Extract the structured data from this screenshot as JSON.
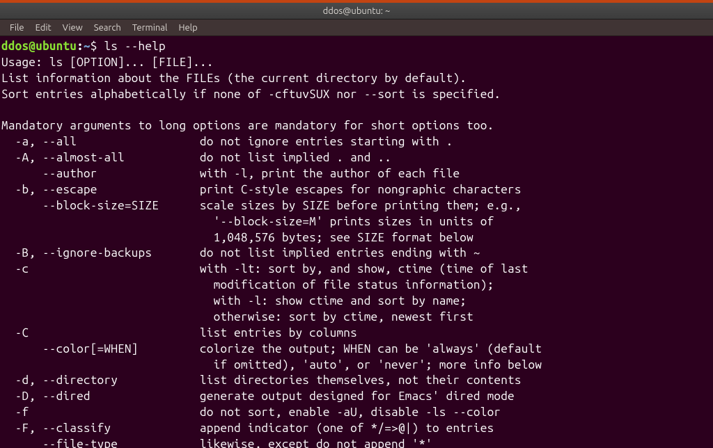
{
  "window": {
    "title": "ddos@ubuntu: ~"
  },
  "menu": {
    "file": "File",
    "edit": "Edit",
    "view": "View",
    "search": "Search",
    "terminal": "Terminal",
    "help": "Help"
  },
  "prompt": {
    "user_host": "ddos@ubuntu",
    "sep": ":",
    "path": "~",
    "dollar": "$ "
  },
  "command": "ls --help",
  "output": [
    "Usage: ls [OPTION]... [FILE]...",
    "List information about the FILEs (the current directory by default).",
    "Sort entries alphabetically if none of -cftuvSUX nor --sort is specified.",
    "",
    "Mandatory arguments to long options are mandatory for short options too.",
    "  -a, --all                  do not ignore entries starting with .",
    "  -A, --almost-all           do not list implied . and ..",
    "      --author               with -l, print the author of each file",
    "  -b, --escape               print C-style escapes for nongraphic characters",
    "      --block-size=SIZE      scale sizes by SIZE before printing them; e.g.,",
    "                               '--block-size=M' prints sizes in units of",
    "                               1,048,576 bytes; see SIZE format below",
    "  -B, --ignore-backups       do not list implied entries ending with ~",
    "  -c                         with -lt: sort by, and show, ctime (time of last",
    "                               modification of file status information);",
    "                               with -l: show ctime and sort by name;",
    "                               otherwise: sort by ctime, newest first",
    "  -C                         list entries by columns",
    "      --color[=WHEN]         colorize the output; WHEN can be 'always' (default",
    "                               if omitted), 'auto', or 'never'; more info below",
    "  -d, --directory            list directories themselves, not their contents",
    "  -D, --dired                generate output designed for Emacs' dired mode",
    "  -f                         do not sort, enable -aU, disable -ls --color",
    "  -F, --classify             append indicator (one of */=>@|) to entries",
    "      --file-type            likewise, except do not append '*'"
  ]
}
